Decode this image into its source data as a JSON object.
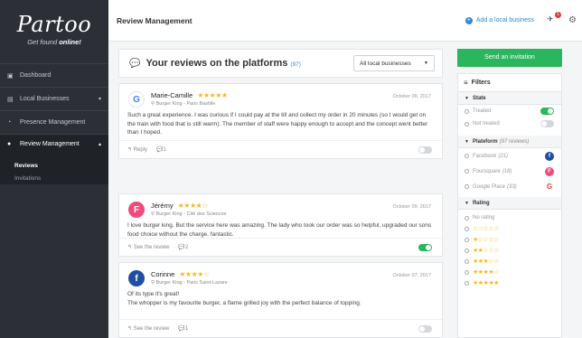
{
  "app": {
    "brand": "Partoo",
    "tagline_prefix": "Get found ",
    "tagline_bold": "online!"
  },
  "sidebar": {
    "items": [
      {
        "label": "Dashboard",
        "icon": "dashboard-icon",
        "glyph": "▣"
      },
      {
        "label": "Local Businesses",
        "icon": "building-icon",
        "glyph": "▤",
        "chevron": "▾"
      },
      {
        "label": "Presence Management",
        "icon": "signal-icon",
        "glyph": "◔"
      },
      {
        "label": "Review Management",
        "icon": "chat-icon",
        "glyph": "●",
        "chevron": "▴",
        "active": true
      }
    ],
    "subitems": [
      {
        "label": "Reviews",
        "selected": true
      },
      {
        "label": "Invitations",
        "selected": false
      }
    ]
  },
  "header": {
    "title": "Review Management",
    "add_label": "Add a local business",
    "notif_count": "1"
  },
  "reviews_panel": {
    "title": "Your reviews on the platforms",
    "count": "(97)",
    "filter_value": "All local businesses"
  },
  "reviews": [
    {
      "name": "Marie-Camille",
      "stars": "★★★★★",
      "place": "Burger King - Paris Bastille",
      "date": "October 09, 2017",
      "platform": "google",
      "text": "Such a great experience. I was curious if I could pay at the till and collect my order in 20 minutes (so I would get on the train with food that is still warm). The member of staff were happy enough to accept and the concept went better than I hoped.",
      "action": "Reply",
      "comments": "1",
      "treated": false
    },
    {
      "name": "Jérémy",
      "stars": "★★★★☆",
      "place": "Burger King - Cité des Sciences",
      "date": "October 09, 2017",
      "platform": "foursquare",
      "text": "I love burger king. But the service here was amazing. The lady who took our order was so helpful, upgraded our sons food choice without the charge. fantastic.",
      "action": "See the review",
      "comments": "2",
      "treated": true
    },
    {
      "name": "Corinne",
      "stars": "★★★★☆",
      "place": "Burger King - Paris Saint-Lazare",
      "date": "October 07, 2017",
      "platform": "facebook",
      "text": "Of its type it's great!\nThe whopper is my favourite burger, a flame grilled joy with the perfect balance of topping.",
      "action": "See the review",
      "comments": "1",
      "treated": false
    }
  ],
  "right": {
    "send_label": "Send an invitation",
    "filters_title": "Filters",
    "state": {
      "title": "State",
      "options": [
        {
          "label": "Treated",
          "on": true
        },
        {
          "label": "Not treated",
          "on": false
        }
      ]
    },
    "platform": {
      "title": "Plateform",
      "sub": "(97 reviews)",
      "options": [
        {
          "label": "Facebook",
          "count": "(21)",
          "icon": "facebook-icon",
          "glyph": "f",
          "color": "#1d4ea3"
        },
        {
          "label": "Foursquare",
          "count": "(18)",
          "icon": "foursquare-icon",
          "glyph": "F",
          "color": "#f04a7c"
        },
        {
          "label": "Google Place",
          "count": "(33)",
          "icon": "google-icon",
          "glyph": "G",
          "color": "#ffffff"
        }
      ]
    },
    "rating": {
      "title": "Rating",
      "options": [
        "No rating",
        "☆☆☆☆☆",
        "★☆☆☆☆",
        "★★☆☆☆",
        "★★★☆☆",
        "★★★★☆",
        "★★★★★"
      ]
    }
  },
  "colors": {
    "sidebar_bg": "#2c2f36",
    "accent_green": "#29b65c",
    "link_blue": "#2a8bd8",
    "star": "#f5b921"
  }
}
